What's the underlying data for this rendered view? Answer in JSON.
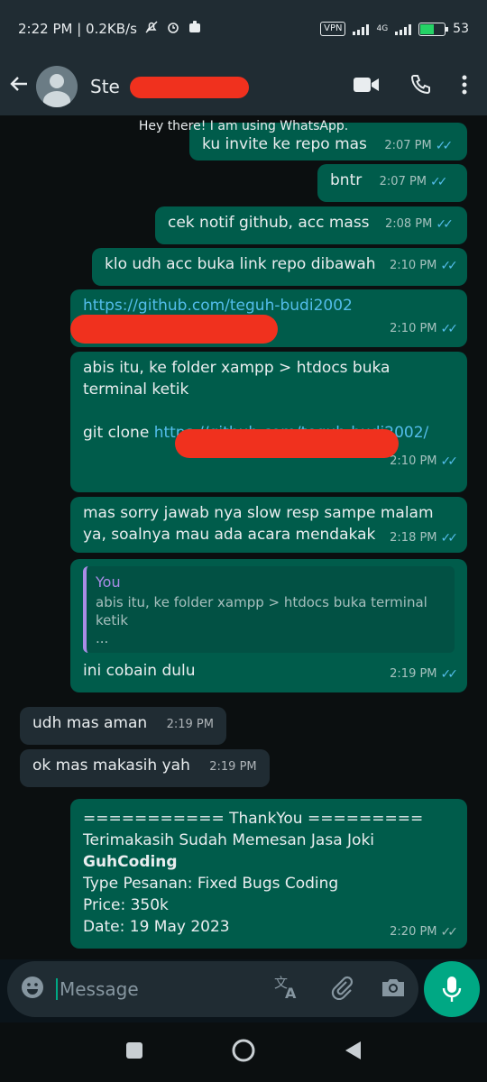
{
  "status_bar": {
    "time": "2:22 PM | 0.2KB/s",
    "vpn": "VPN",
    "network": "4G",
    "battery": "53",
    "battery_level": 0.53
  },
  "header": {
    "contact_name": "Ste"
  },
  "chat": {
    "contact_status": "Hey there! I am using WhatsApp.",
    "messages": [
      {
        "dir": "out",
        "text": "ku invite ke repo mas",
        "time": "2:07 PM"
      },
      {
        "dir": "out",
        "text": "bntr",
        "time": "2:07 PM"
      },
      {
        "dir": "out",
        "text": "cek notif github, acc mass",
        "time": "2:08 PM"
      },
      {
        "dir": "out",
        "text": "klo udh acc buka link repo dibawah",
        "time": "2:10 PM"
      },
      {
        "dir": "out",
        "link": "https://github.com/teguh-budi2002",
        "time": "2:10 PM"
      },
      {
        "dir": "out",
        "text": "abis itu, ke folder xampp > htdocs buka terminal ketik",
        "code_prefix": "git clone ",
        "link": "https://github.com/teguh-budi2002/",
        "time": "2:10 PM"
      },
      {
        "dir": "out",
        "text": "mas sorry jawab nya slow resp sampe malam ya, soalnya mau ada acara mendakak",
        "time": "2:18 PM"
      },
      {
        "dir": "out",
        "quote_author": "You",
        "quote_text": "abis itu, ke folder xampp > htdocs buka terminal ketik",
        "quote_more": "...",
        "text": "ini cobain dulu",
        "time": "2:19 PM"
      },
      {
        "dir": "in",
        "text": "udh mas aman",
        "time": "2:19 PM"
      },
      {
        "dir": "in",
        "text": "ok mas makasih yah",
        "time": "2:19 PM"
      },
      {
        "dir": "out",
        "line1": "=========== ThankYou =========",
        "line2": "Terimakasih Sudah Memesan Jasa Joki",
        "line3": "GuhCoding",
        "line4": "Type Pesanan: Fixed Bugs Coding",
        "line5": "Price: 350k",
        "line6": "Date: 19 May 2023",
        "time": "2:20 PM"
      }
    ]
  },
  "composer": {
    "placeholder": "Message"
  },
  "icons": {
    "back": "arrow-left-icon",
    "video": "video-call-icon",
    "voice": "phone-icon",
    "menu": "more-vert-icon",
    "emoji": "emoji-icon",
    "translate": "translate-icon",
    "attach": "paperclip-icon",
    "camera": "camera-icon",
    "mic": "mic-icon"
  },
  "colors": {
    "outgoing_bubble": "#005c4b",
    "incoming_bubble": "#202c33",
    "accent": "#00a884",
    "read_ticks": "#53bdeb",
    "redaction": "#f0311e"
  }
}
